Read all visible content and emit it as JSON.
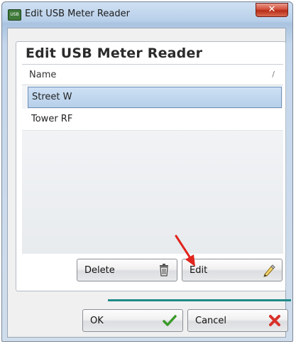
{
  "window": {
    "title": "Edit USB Meter Reader",
    "close_glyph": "✕",
    "icon": "usb-app-icon",
    "icon_text": "USB"
  },
  "panel": {
    "title": "Edit USB Meter Reader"
  },
  "grid": {
    "columns": [
      "Name"
    ],
    "sort_glyph": "/",
    "rows": [
      {
        "name": "Street W",
        "selected": true
      },
      {
        "name": "Tower RF",
        "selected": false
      }
    ]
  },
  "buttons": {
    "delete_label": "Delete",
    "edit_label": "Edit",
    "ok_label": "OK",
    "cancel_label": "Cancel"
  },
  "icons": {
    "delete": "trash-icon",
    "edit": "pencil-icon",
    "ok": "checkmark-icon",
    "cancel": "x-icon",
    "annotation": "red-arrow-icon"
  },
  "colors": {
    "selection": "#b6cfe9",
    "accent_line": "#1f8a87",
    "ok_check": "#3a9a2a",
    "cancel_x": "#d8312a",
    "annotation_arrow": "#e0241e"
  }
}
